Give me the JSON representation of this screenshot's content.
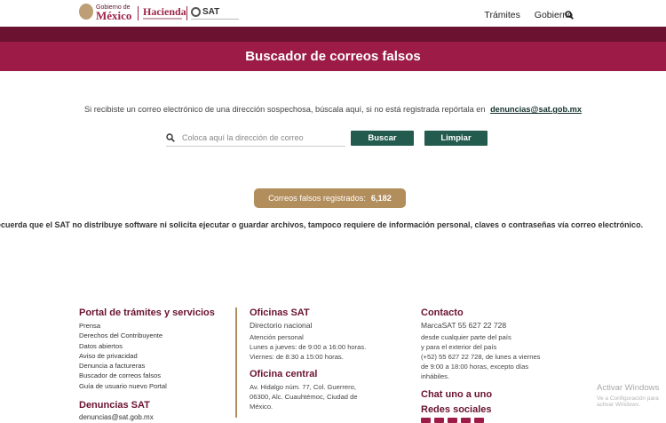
{
  "header": {
    "gob_small": "Gobierno de",
    "gob_big": "México",
    "hacienda": "Hacienda",
    "sat": "SAT",
    "nav": [
      "Trámites",
      "Gobierno"
    ]
  },
  "page_title": "Buscador de correos falsos",
  "intro": {
    "text": "Si recibiste un correo electrónico de una dirección sospechosa, búscala aquí, si no está registrada repórtala en",
    "email": "denuncias@sat.gob.mx"
  },
  "search": {
    "placeholder": "Coloca aquí la dirección de correo",
    "value": "",
    "buscar_label": "Buscar",
    "limpiar_label": "Limpiar"
  },
  "badge": {
    "label": "Correos falsos registrados:",
    "count": "6,182"
  },
  "reminder": "ecuerda que el SAT no distribuye software ni solicita ejecutar o guardar archivos, tampoco requiere de información personal, claves o contraseñas vía correo electrónico.",
  "footer": {
    "col1": {
      "title": "Portal de trámites y servicios",
      "links": [
        "Prensa",
        "Derechos del Contribuyente",
        "Datos abiertos",
        "Aviso de privacidad",
        "Denuncia a factureras",
        "Buscador de correos falsos",
        "Guía de usuario nuevo Portal"
      ],
      "title2": "Denuncias SAT",
      "email": "denuncias@sat.gob.mx"
    },
    "col2": {
      "title": "Oficinas SAT",
      "sub": "Directorio nacional",
      "lines": [
        "Atención personal",
        "Lunes a jueves: de 9:00 a 16:00 horas.",
        "Viernes: de 8:30 a 15:00 horas."
      ],
      "title2": "Oficina central",
      "address": [
        "Av. Hidalgo núm. 77, Col. Guerrero,",
        "06300, Alc. Cuauhtémoc, Ciudad de",
        "México."
      ]
    },
    "col3": {
      "title": "Contacto",
      "sub": "MarcaSAT 55 627 22 728",
      "lines": [
        "desde cualquier parte del país",
        "y para el exterior del país",
        "(+52) 55 627 22 728, de lunes a viernes",
        "de 9:00 a 18:00 horas, excepto días",
        "inhábiles."
      ],
      "title2": "Chat uno a uno",
      "title3": "Redes sociales"
    }
  },
  "watermark": {
    "title": "Activar Windows",
    "sub": "Ve a Configuración para activar Windows."
  },
  "colors": {
    "primary_dark": "#6a1230",
    "primary": "#9c1c47",
    "green": "#235b4e",
    "gold": "#b38e5d"
  }
}
